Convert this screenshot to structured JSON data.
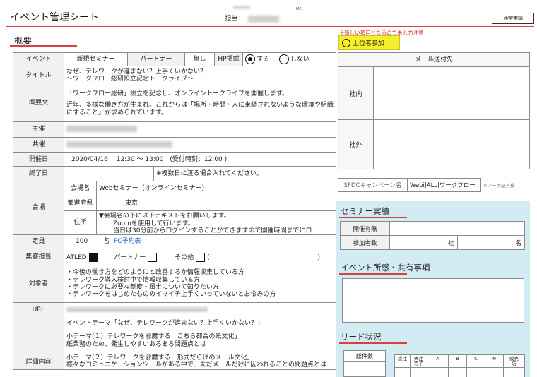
{
  "header": {
    "title": "イベント管理シート",
    "owner_label": "担当：",
    "mc_tag": "MC",
    "apply_button": "通常申請"
  },
  "overview": {
    "title": "概要",
    "warning_note": "※新しい項目となるので未入力注意",
    "upper_join_label": "上位者参加"
  },
  "form": {
    "event": {
      "label": "イベント",
      "value": "新規セミナー",
      "partner_label": "パートナー",
      "partner_value": "無し",
      "hp_label": "HP掲載",
      "hp_yes": "する",
      "hp_no": "しない",
      "hp_selected": "する"
    },
    "title": {
      "label": "タイトル",
      "line1": "なぜ、テレワークが進まない？上手くいかない？",
      "line2": "～ワークフロー総研設立記念トークライブ～"
    },
    "summary": {
      "label": "概要文",
      "line1": "「ワークフロー総研」設立を記念し、オンライントークライブを開催します。",
      "line2": "近年、多様な働き方が生まれ、これからは「場所・時間・人に束縛されないような環境や組織にすること」が求められています。"
    },
    "host": {
      "label": "主催"
    },
    "cohost": {
      "label": "共催"
    },
    "date": {
      "label": "開催日",
      "value": "2020/04/16　 12:30 ～ 13:00　(受付時刻：12:00 )"
    },
    "end_date": {
      "label": "終了日",
      "note": "※複数日に渡る場合入れてください。"
    },
    "venue": {
      "label": "会場",
      "name_label": "会場名",
      "name_value": "Webセミナー（オンラインセミナー）",
      "pref_label": "都道府県",
      "pref_value": "東京",
      "address_label": "住所",
      "address_line1": "▼会場名の下に以下テキストをお願いします。",
      "address_line2": "Zoomを使用して行います。",
      "address_line3": "当日は30分前からログインすることができますので開催時間までにロ"
    },
    "capacity": {
      "label": "定員",
      "value": "100",
      "unit": "名",
      "link": "PC予約表"
    },
    "recruit": {
      "label": "集客担当",
      "atled": "ATLED",
      "partner": "パートナー",
      "other": "その他",
      "paren_open": "(",
      "paren_close": ")"
    },
    "audience": {
      "label": "対象者",
      "items": [
        "・今後の働き方をどのようにと改善するか情報収集している方",
        "・テレワーク導入検討中で情報収集している方",
        "・テレワークに必要な制度・風土について知りたい方",
        "・テレワークをはじめたもののイマイチ上手くいっていないとお悩みの方"
      ]
    },
    "url": {
      "label": "URL"
    },
    "details": {
      "label": "詳細内容",
      "line1": "イベントテーマ「なぜ、テレワークが進まない？上手くいかない？」",
      "line2": "小テーマ(１）テレワークを邪魔する「こちら都合の紙文化」",
      "line3": "紙業務のため、発生しやすいあるある問題点とは",
      "line4": "小テーマ(２）テレワークを邪魔する「形式だらけのメール文化」",
      "line5": "様々なコミュニケーションツールがある中で、未だメールだけに囚われることの問題点とは"
    }
  },
  "mail": {
    "title": "メール送付先",
    "internal": "社内",
    "external": "社外"
  },
  "sfdc": {
    "label": "SFDCキャンペーン名",
    "value": "Webi|ALL|ワークフロー",
    "note": "※マーケ記入欄"
  },
  "seminar_results": {
    "title": "セミナー実績",
    "held_label": "開催有無",
    "participants_label": "参加者数",
    "company_unit": "社",
    "person_unit": "名"
  },
  "impressions": {
    "title": "イベント所感・共有事項"
  },
  "leads": {
    "title": "リード状況",
    "total_label": "総件数",
    "columns": [
      "受注",
      "失注\n完了",
      "A",
      "B",
      "C",
      "N",
      "販売\n店"
    ]
  },
  "colors": {
    "accent_red": "#d94040",
    "panel_blue": "#d3ecf3",
    "highlight_yellow": "#f7ef2a",
    "link_blue": "#1a4fc4"
  }
}
